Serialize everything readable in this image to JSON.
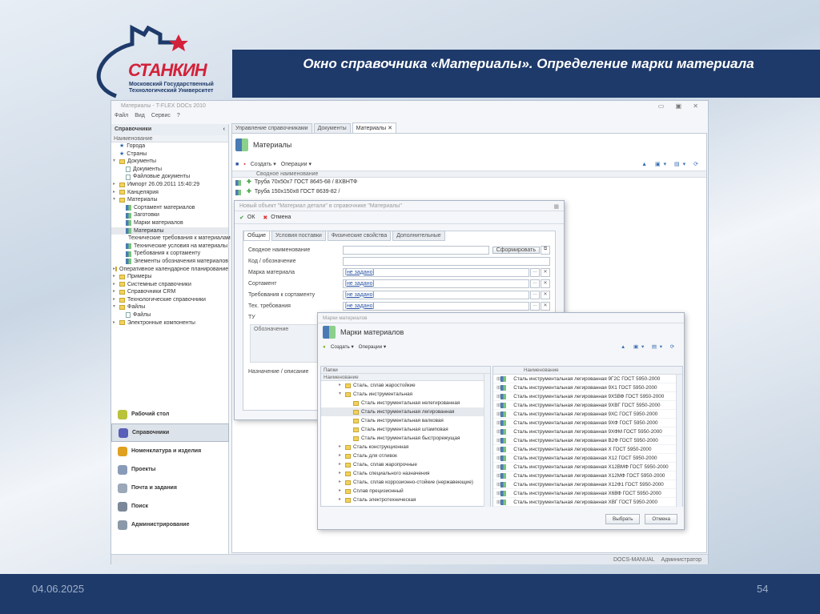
{
  "slide": {
    "title": "Окно справочника «Материалы». Определение марки материала",
    "date": "04.06.2025",
    "page": "54",
    "logo": {
      "name": "СТАНКИН",
      "subtitle": "Московский Государственный Технологический Университет"
    }
  },
  "app": {
    "title": "Материалы - T-FLEX DOCs 2010",
    "menu": [
      "Файл",
      "Вид",
      "Сервис",
      "?"
    ],
    "left_panel": {
      "title": "Справочники",
      "collapse": "‹",
      "column": "Наименование",
      "tree": [
        {
          "label": "Города",
          "level": 1,
          "icon": "star"
        },
        {
          "label": "Страны",
          "level": 1,
          "icon": "star"
        },
        {
          "label": "Документы",
          "level": 0,
          "icon": "folder",
          "exp": "open"
        },
        {
          "label": "Документы",
          "level": 2,
          "icon": "doc"
        },
        {
          "label": "Файловые документы",
          "level": 2,
          "icon": "doc"
        },
        {
          "label": "Импорт 26.09.2011 15:40:29",
          "level": 0,
          "icon": "folder",
          "exp": "closed"
        },
        {
          "label": "Канцелярия",
          "level": 0,
          "icon": "folder",
          "exp": "closed"
        },
        {
          "label": "Материалы",
          "level": 0,
          "icon": "folder",
          "exp": "open"
        },
        {
          "label": "Сортамент материалов",
          "level": 2,
          "icon": "mat"
        },
        {
          "label": "Заготовки",
          "level": 2,
          "icon": "mat"
        },
        {
          "label": "Марки материалов",
          "level": 2,
          "icon": "mat"
        },
        {
          "label": "Материалы",
          "level": 2,
          "icon": "mat",
          "selected": true
        },
        {
          "label": "Технические требования к материалам",
          "level": 2,
          "icon": "mat"
        },
        {
          "label": "Технические условия на материалы",
          "level": 2,
          "icon": "mat"
        },
        {
          "label": "Требования к сортаменту",
          "level": 2,
          "icon": "mat"
        },
        {
          "label": "Элементы обозначения материалов",
          "level": 2,
          "icon": "mat"
        },
        {
          "label": "Оперативное календарное планирование",
          "level": 0,
          "icon": "folder",
          "exp": "closed"
        },
        {
          "label": "Примеры",
          "level": 0,
          "icon": "folder",
          "exp": "closed"
        },
        {
          "label": "Системные справочники",
          "level": 0,
          "icon": "folder",
          "exp": "closed"
        },
        {
          "label": "Справочники CRM",
          "level": 0,
          "icon": "folder",
          "exp": "closed"
        },
        {
          "label": "Технологические справочники",
          "level": 0,
          "icon": "folder",
          "exp": "closed"
        },
        {
          "label": "Файлы",
          "level": 0,
          "icon": "folder",
          "exp": "open"
        },
        {
          "label": "Файлы",
          "level": 2,
          "icon": "doc"
        },
        {
          "label": "Электронные компоненты",
          "level": 0,
          "icon": "folder",
          "exp": "closed"
        }
      ],
      "nav": [
        {
          "label": "Рабочий стол",
          "color": "#b8c23a"
        },
        {
          "label": "Справочники",
          "color": "#5a5fb8",
          "selected": true
        },
        {
          "label": "Номенклатура и изделия",
          "color": "#e0a020"
        },
        {
          "label": "Проекты",
          "color": "#8a9bb8"
        },
        {
          "label": "Почта и задания",
          "color": "#9aa8b8"
        },
        {
          "label": "Поиск",
          "color": "#7a8898"
        },
        {
          "label": "Администрирование",
          "color": "#8a98a8"
        }
      ]
    },
    "tabs": [
      "Управление справочниками",
      "Документы",
      "Материалы"
    ],
    "pane": {
      "title": "Материалы",
      "create": "Создать ▾",
      "operations": "Операции ▾",
      "column": "Сводное наименование",
      "rows": [
        "Труба 70x50x7 ГОСТ 8645-68 / 8ХВНТФ",
        "Труба 150x150x8 ГОСТ 8639-82 /"
      ]
    },
    "dialog1": {
      "title": "Новый объект \"Материал детали\" в справочнике \"Материалы\"",
      "ok": "ОК",
      "cancel": "Отмена",
      "tabs": [
        "Общие",
        "Условия поставки",
        "Физические свойства",
        "Дополнительные"
      ],
      "fields": [
        {
          "label": "Сводное наименование",
          "value": "",
          "button": "Сформировать"
        },
        {
          "label": "Код / обозначение",
          "value": ""
        },
        {
          "label": "Марка материала",
          "value": "[не задано]"
        },
        {
          "label": "Сортамент",
          "value": "[не задано]"
        },
        {
          "label": "Требования к сортаменту",
          "value": "[не задано]"
        },
        {
          "label": "Тех. требования",
          "value": "[не задано]"
        }
      ],
      "tu_label": "ТУ",
      "tu_column": "Обозначение",
      "desc_label": "Назначение / описание"
    },
    "dialog2": {
      "title": "Марки материалов",
      "header": "Марки материалов",
      "create": "Создать ▾",
      "operations": "Операции ▾",
      "folders_label": "Папки",
      "column": "Наименование",
      "folders": [
        {
          "label": "Сталь, сплав жаростойкие",
          "level": 0
        },
        {
          "label": "Сталь инструментальная",
          "level": 0,
          "exp": "open"
        },
        {
          "label": "Сталь инструментальная нелегированная",
          "level": 1
        },
        {
          "label": "Сталь инструментальная легированная",
          "level": 1,
          "selected": true
        },
        {
          "label": "Сталь инструментальная валковая",
          "level": 1
        },
        {
          "label": "Сталь инструментальная штамповая",
          "level": 1
        },
        {
          "label": "Сталь инструментальная быстрорежущая",
          "level": 1
        },
        {
          "label": "Сталь конструкционная",
          "level": 0
        },
        {
          "label": "Сталь для отливок",
          "level": 0
        },
        {
          "label": "Сталь, сплав жаропрочные",
          "level": 0
        },
        {
          "label": "Сталь специального назначения",
          "level": 0
        },
        {
          "label": "Сталь, сплав коррозионно-стойкие (нержавеющие)",
          "level": 0
        },
        {
          "label": "Сплав прецизионный",
          "level": 0
        },
        {
          "label": "Сталь электротехническая",
          "level": 0
        }
      ],
      "items": [
        "Сталь инструментальная легированная 9Г2С ГОСТ 5950-2000",
        "Сталь инструментальная легированная 9Х1 ГОСТ 5950-2000",
        "Сталь инструментальная легированная 9Х5ВФ ГОСТ 5950-2000",
        "Сталь инструментальная легированная 9ХВГ ГОСТ 5950-2000",
        "Сталь инструментальная легированная 9ХС ГОСТ 5950-2000",
        "Сталь инструментальная легированная 9ХФ ГОСТ 5950-2000",
        "Сталь инструментальная легированная 9ХФМ ГОСТ 5950-2000",
        "Сталь инструментальная легированная В2Ф ГОСТ 5950-2000",
        "Сталь инструментальная легированная Х ГОСТ 5950-2000",
        "Сталь инструментальная легированная Х12 ГОСТ 5950-2000",
        "Сталь инструментальная легированная Х12ВМФ ГОСТ 5950-2000",
        "Сталь инструментальная легированная Х12МФ ГОСТ 5950-2000",
        "Сталь инструментальная легированная Х12Ф1 ГОСТ 5950-2000",
        "Сталь инструментальная легированная Х6ВФ ГОСТ 5950-2000",
        "Сталь инструментальная легированная ХВГ ГОСТ 5950-2000"
      ],
      "select": "Выбрать",
      "cancel": "Отмена"
    },
    "status": {
      "server": "DOCS-MANUAL",
      "user": "Администратор"
    }
  }
}
